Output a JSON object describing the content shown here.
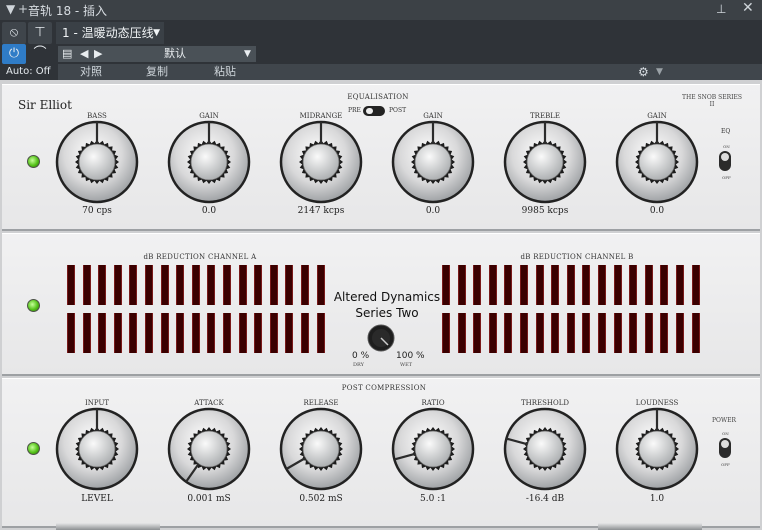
{
  "window": {
    "title": "音轨 18 - 插入"
  },
  "header": {
    "insert_name": "1 - 温暖动态压线",
    "preset": "默认",
    "compare_label": "对照",
    "copy_label": "复制",
    "paste_label": "粘贴",
    "auto_label": "Auto: Off"
  },
  "plugin": {
    "brand": "Sir Elliot",
    "series_top": "THE SNOB SERIES",
    "series_bottom": "II",
    "eq_title": "EQUALISATION",
    "pre_label": "PRE",
    "post_label": "POST",
    "eq_label": "EQ",
    "eq_on": "ON",
    "eq_off": "OFF",
    "eq_knobs": [
      {
        "label": "BASS",
        "value": "70 cps",
        "angle": 0
      },
      {
        "label": "GAIN",
        "value": "0.0",
        "angle": 0
      },
      {
        "label": "MIDRANGE",
        "value": "2147 kcps",
        "angle": 0
      },
      {
        "label": "GAIN",
        "value": "0.0",
        "angle": 0
      },
      {
        "label": "TREBLE",
        "value": "9985 kcps",
        "angle": 0
      },
      {
        "label": "GAIN",
        "value": "0.0",
        "angle": 0
      }
    ],
    "channel_a": "dB REDUCTION CHANNEL A",
    "channel_b": "dB REDUCTION CHANNEL B",
    "center_line1": "Altered Dynamics",
    "center_line2": "Series Two",
    "dry_pct": "0 %",
    "wet_pct": "100 %",
    "dry_label": "DRY",
    "wet_label": "WET",
    "post_title": "POST COMPRESSION",
    "power_label": "POWER",
    "power_on": "ON",
    "power_off": "OFF",
    "post_knobs": [
      {
        "label": "INPUT",
        "value": "LEVEL",
        "angle": 0
      },
      {
        "label": "ATTACK",
        "value": "0.001 mS",
        "angle": -145
      },
      {
        "label": "RELEASE",
        "value": "0.502 mS",
        "angle": -120
      },
      {
        "label": "RATIO",
        "value": "5.0 :1",
        "angle": -105
      },
      {
        "label": "THRESHOLD",
        "value": "-16.4 dB",
        "angle": -75
      },
      {
        "label": "LOUDNESS",
        "value": "1.0",
        "angle": 0
      }
    ]
  }
}
